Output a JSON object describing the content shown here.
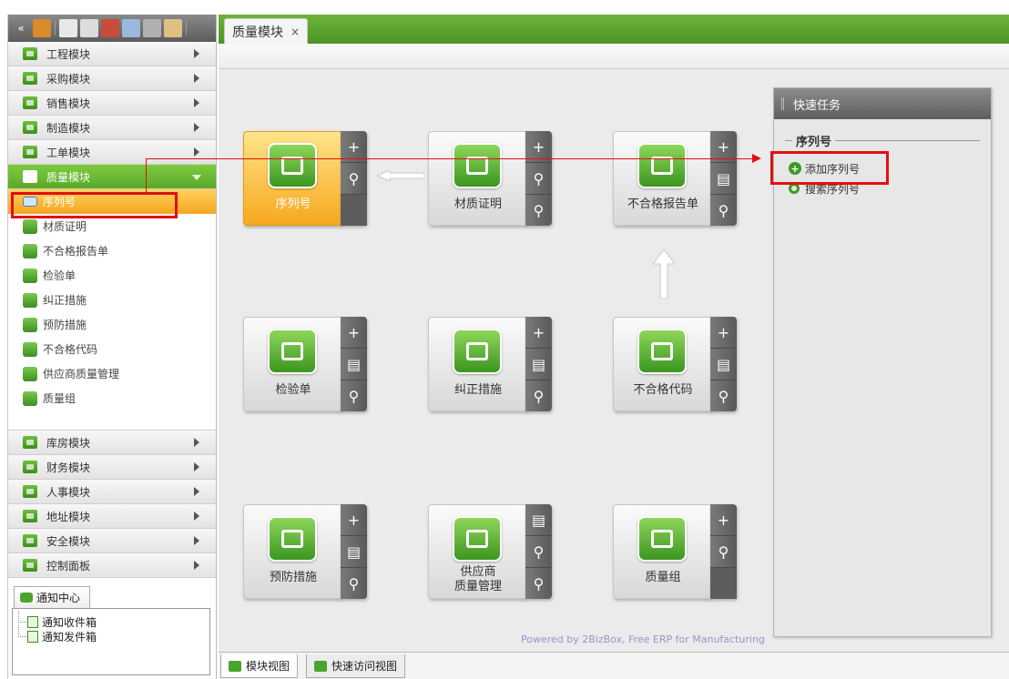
{
  "toolbar": {
    "icons": [
      "collapse-icon",
      "users-icon",
      "mail-icon",
      "document-icon",
      "chart-icon",
      "window-icon",
      "settings-icon",
      "home-icon"
    ]
  },
  "sidebar": {
    "modules_top": [
      {
        "label": "工程模块"
      },
      {
        "label": "采购模块"
      },
      {
        "label": "销售模块"
      },
      {
        "label": "制造模块"
      },
      {
        "label": "工单模块"
      },
      {
        "label": "质量模块"
      }
    ],
    "quality_items": [
      {
        "label": "序列号"
      },
      {
        "label": "材质证明"
      },
      {
        "label": "不合格报告单"
      },
      {
        "label": "检验单"
      },
      {
        "label": "纠正措施"
      },
      {
        "label": "预防措施"
      },
      {
        "label": "不合格代码"
      },
      {
        "label": "供应商质量管理"
      },
      {
        "label": "质量组"
      }
    ],
    "modules_bottom": [
      {
        "label": "库房模块"
      },
      {
        "label": "财务模块"
      },
      {
        "label": "人事模块"
      },
      {
        "label": "地址模块"
      },
      {
        "label": "安全模块"
      },
      {
        "label": "控制面板"
      }
    ],
    "notice": {
      "tab_label": "通知中心",
      "items": [
        {
          "label": "通知收件箱"
        },
        {
          "label": "通知发件箱"
        }
      ]
    }
  },
  "tabs": {
    "active_label": "质量模块",
    "close_glyph": "×"
  },
  "cards": [
    {
      "label": "序列号",
      "buttons": [
        "+",
        "⚲",
        ""
      ]
    },
    {
      "label": "材质证明",
      "buttons": [
        "+",
        "⚲",
        "⚲"
      ]
    },
    {
      "label": "不合格报告单",
      "buttons": [
        "+",
        "▤",
        "⚲"
      ]
    },
    {
      "label": "检验单",
      "buttons": [
        "+",
        "▤",
        "⚲"
      ]
    },
    {
      "label": "纠正措施",
      "buttons": [
        "+",
        "▤",
        "⚲"
      ]
    },
    {
      "label": "不合格代码",
      "buttons": [
        "+",
        "▤",
        "⚲"
      ]
    },
    {
      "label": "预防措施",
      "buttons": [
        "+",
        "▤",
        "⚲"
      ]
    },
    {
      "label_line1": "供应商",
      "label_line2": "质量管理",
      "buttons": [
        "▤",
        "⚲",
        "⚲"
      ]
    },
    {
      "label": "质量组",
      "buttons": [
        "+",
        "⚲",
        ""
      ]
    }
  ],
  "powered_by": "Powered by 2BizBox, Free ERP for Manufacturing",
  "quick_tasks": {
    "title": "快速任务",
    "section": "序列号",
    "add_label": "添加序列号",
    "search_label": "搜索序列号"
  },
  "bottom_tabs": [
    {
      "label": "模块视图"
    },
    {
      "label": "快速访问视图"
    }
  ],
  "colors": {
    "accent_green": "#5ba82a",
    "selected_yellow": "#f5a623",
    "highlight_red": "#e01010"
  }
}
